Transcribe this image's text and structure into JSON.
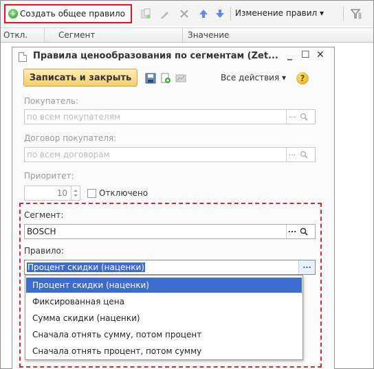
{
  "toolbar": {
    "create_rule_label": "Создать общее правило",
    "change_rules_label": "Изменение правил ▾"
  },
  "table": {
    "columns": [
      "Откл.",
      "Сегмент",
      "Значение"
    ]
  },
  "dialog": {
    "title": "Правила ценообразования по сегментам (Zet...",
    "save_close_label": "Записать и закрыть",
    "all_actions_label": "Все действия ▾",
    "help_label": "?",
    "fields": {
      "buyer_label": "Покупатель:",
      "buyer_placeholder": "по всем покупателям",
      "contract_label": "Договор покупателя:",
      "contract_placeholder": "по всем договорам",
      "priority_label": "Приоритет:",
      "priority_value": "10",
      "disabled_label": "Отключено",
      "segment_label": "Сегмент:",
      "segment_value": "BOSCH",
      "rule_label": "Правило:",
      "rule_value": "Процент скидки (наценки)"
    },
    "rule_options": [
      "Процент скидки (наценки)",
      "Фиксированная цена",
      "Сумма скидки (наценки)",
      "Сначала отнять сумму, потом процент",
      "Сначала отнять процент, потом сумму"
    ],
    "selected_option_index": 0
  },
  "colors": {
    "highlight_red": "#e0141c",
    "selection_blue": "#3d6dcc",
    "primary_button": "#f6cf6a"
  }
}
